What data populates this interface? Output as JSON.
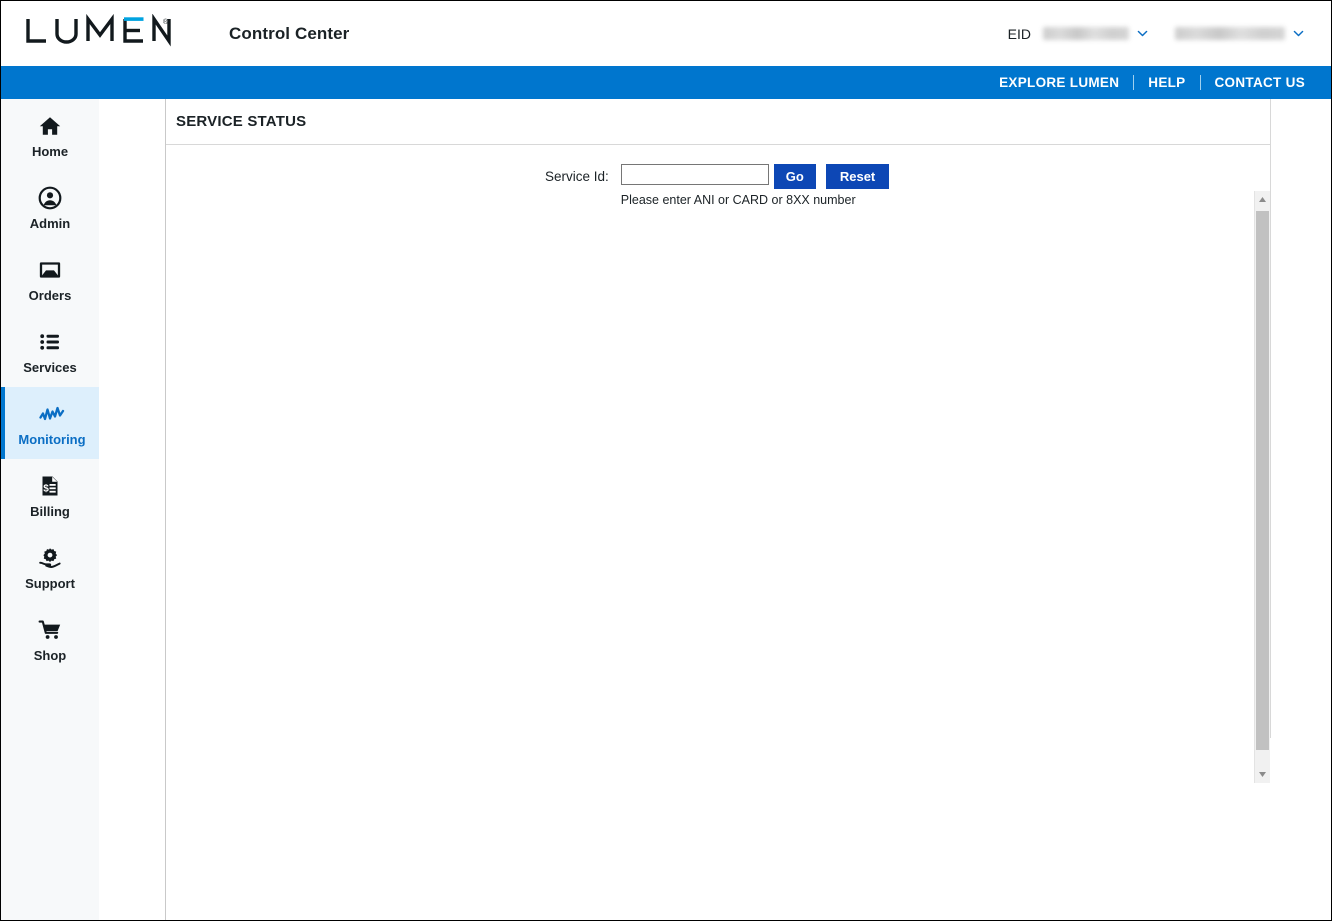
{
  "header": {
    "logo_text": "LUMEN",
    "logo_trademark": "®",
    "app_title": "Control Center",
    "eid_label": "EID",
    "eid_value_redacted": true,
    "user_value_redacted": true,
    "eid_chevron_icon": "chevron-down-icon",
    "user_chevron_icon": "chevron-down-icon"
  },
  "navbar": {
    "background_color": "#0076ce",
    "links": [
      {
        "label": "EXPLORE LUMEN"
      },
      {
        "label": "HELP"
      },
      {
        "label": "CONTACT US"
      }
    ]
  },
  "sidebar": {
    "background_color": "#f7f9fa",
    "active_background_color": "#ddeffc",
    "active_accent_color": "#0076ce",
    "items": [
      {
        "label": "Home",
        "icon": "home-icon",
        "active": false
      },
      {
        "label": "Admin",
        "icon": "user-circle-icon",
        "active": false
      },
      {
        "label": "Orders",
        "icon": "inbox-tray-icon",
        "active": false
      },
      {
        "label": "Services",
        "icon": "list-bullet-icon",
        "active": false
      },
      {
        "label": "Monitoring",
        "icon": "pulse-wave-icon",
        "active": true
      },
      {
        "label": "Billing",
        "icon": "invoice-document-icon",
        "active": false
      },
      {
        "label": "Support",
        "icon": "gear-hand-icon",
        "active": false
      },
      {
        "label": "Shop",
        "icon": "shopping-cart-icon",
        "active": false
      }
    ]
  },
  "main": {
    "panel_title": "SERVICE STATUS",
    "form": {
      "service_id_label": "Service Id:",
      "service_id_value": "",
      "service_id_placeholder": "",
      "go_label": "Go",
      "reset_label": "Reset",
      "help_text": "Please enter ANI or CARD or 8XX number",
      "button_color": "#0d47b5"
    },
    "scrollbar": {
      "up_arrow_icon": "triangle-up-icon",
      "down_arrow_icon": "triangle-down-icon",
      "thumb_color": "#c1c1c1"
    }
  }
}
